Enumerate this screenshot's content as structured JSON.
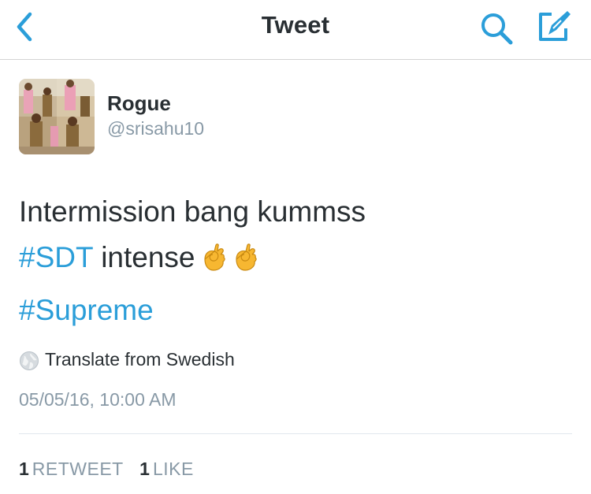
{
  "nav": {
    "title": "Tweet"
  },
  "author": {
    "name": "Rogue",
    "handle": "@srisahu10"
  },
  "tweet": {
    "line1": "Intermission bang kummss",
    "hashtag1": "#SDT",
    "line2_text": " intense",
    "hashtag2": "#Supreme"
  },
  "translate": {
    "label": "Translate from Swedish"
  },
  "timestamp": "05/05/16, 10:00 AM",
  "stats": {
    "retweets_count": "1",
    "retweets_label": "RETWEET",
    "likes_count": "1",
    "likes_label": "LIKE"
  },
  "colors": {
    "accent": "#2b9ed9",
    "text": "#292f33",
    "muted": "#8899a6",
    "divider": "#e1e8ed",
    "emoji": "#f7b731"
  },
  "icons": {
    "back": "chevron-left-icon",
    "search": "search-icon",
    "compose": "compose-icon",
    "globe": "globe-icon",
    "emoji": "ok-hand-emoji"
  }
}
